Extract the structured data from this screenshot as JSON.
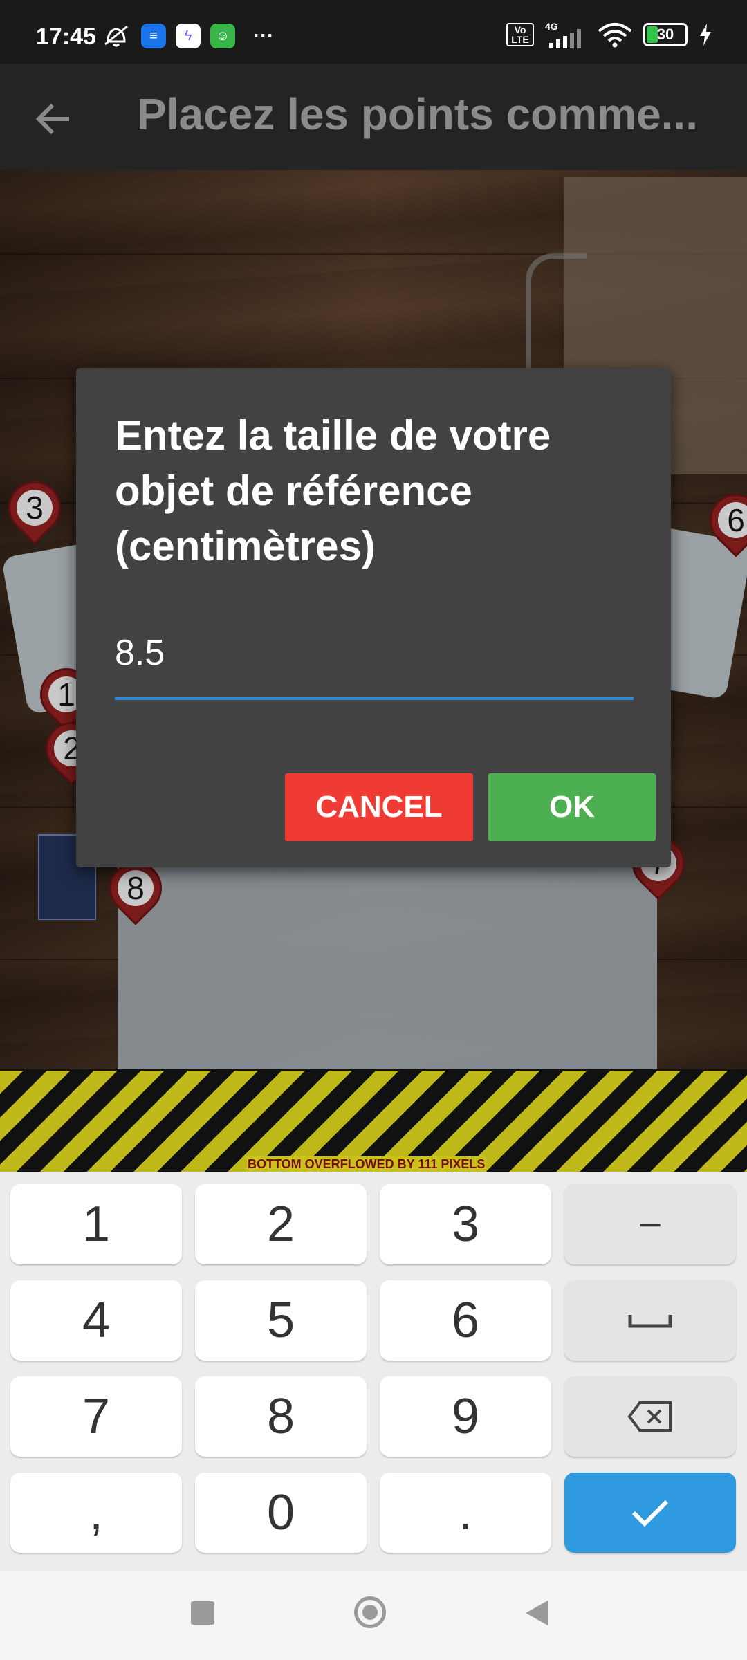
{
  "status_bar": {
    "time": "17:45",
    "more": "···",
    "network": "4G",
    "volte": "Vo LTE",
    "battery": "30"
  },
  "app_bar": {
    "title": "Placez les points comme..."
  },
  "markers": [
    "3",
    "6",
    "1",
    "2",
    "7",
    "8"
  ],
  "overflow_warning": "BOTTOM OVERFLOWED BY 111 PIXELS",
  "dialog": {
    "title": "Entez la taille de votre objet de référence (centimètres)",
    "value": "8.5",
    "cancel_label": "CANCEL",
    "ok_label": "OK"
  },
  "keyboard": {
    "keys": [
      "1",
      "2",
      "3",
      "−",
      "4",
      "5",
      "6",
      "⎵",
      "7",
      "8",
      "9",
      "⌫",
      ",",
      "0",
      ".",
      "✓"
    ]
  },
  "colors": {
    "cancel": "#ef3b34",
    "ok": "#4caf50",
    "accent": "#2f8cda",
    "done_key": "#2f9ae0"
  }
}
